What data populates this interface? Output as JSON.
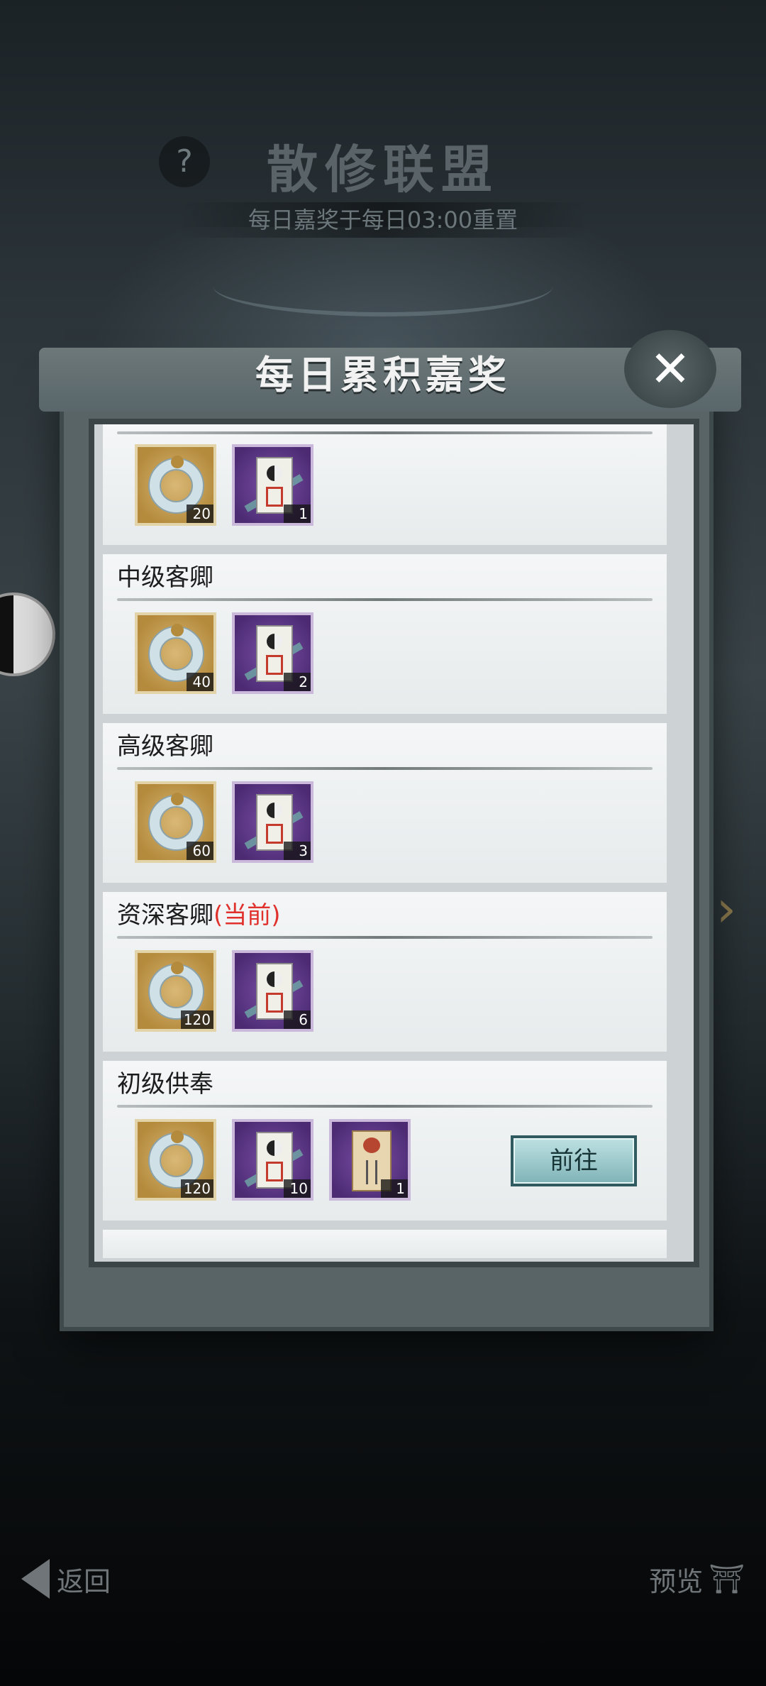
{
  "background": {
    "title": "散修联盟",
    "subtitle": "每日嘉奖于每日03:00重置",
    "help_icon": "question-icon"
  },
  "modal": {
    "title": "每日累积嘉奖",
    "close_icon": "close-icon"
  },
  "tiers": [
    {
      "name": "",
      "current_tag": "",
      "rewards": [
        {
          "type": "jade-ring",
          "qty": "20"
        },
        {
          "type": "talisman",
          "qty": "1"
        }
      ]
    },
    {
      "name": "中级客卿",
      "current_tag": "",
      "rewards": [
        {
          "type": "jade-ring",
          "qty": "40"
        },
        {
          "type": "talisman",
          "qty": "2"
        }
      ]
    },
    {
      "name": "高级客卿",
      "current_tag": "",
      "rewards": [
        {
          "type": "jade-ring",
          "qty": "60"
        },
        {
          "type": "talisman",
          "qty": "3"
        }
      ]
    },
    {
      "name": "资深客卿",
      "current_tag": "(当前)",
      "rewards": [
        {
          "type": "jade-ring",
          "qty": "120"
        },
        {
          "type": "talisman",
          "qty": "6"
        }
      ]
    },
    {
      "name": "初级供奉",
      "current_tag": "",
      "rewards": [
        {
          "type": "jade-ring",
          "qty": "120"
        },
        {
          "type": "talisman",
          "qty": "10"
        },
        {
          "type": "scroll",
          "qty": "1"
        }
      ],
      "action_label": "前往"
    }
  ],
  "nav": {
    "back_label": "返回",
    "preview_label": "预览"
  },
  "colors": {
    "current_tag": "#e0312c",
    "action_button": "#9ccbce"
  }
}
